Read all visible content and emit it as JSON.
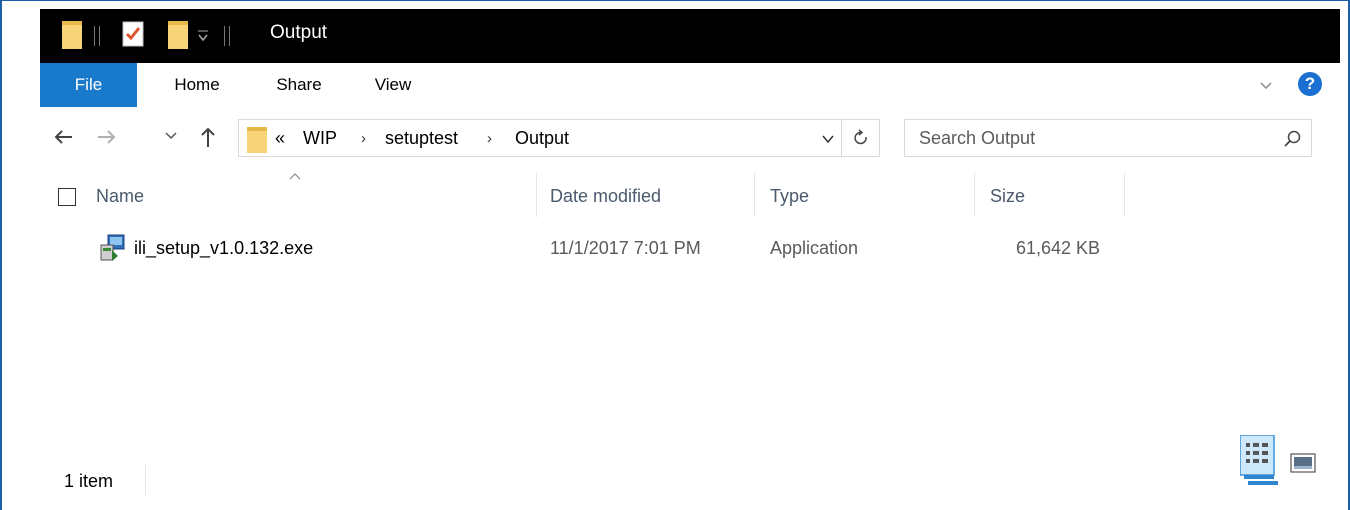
{
  "window": {
    "title": "Output"
  },
  "ribbon": {
    "tabs": [
      {
        "label": "File",
        "active": true
      },
      {
        "label": "Home"
      },
      {
        "label": "Share"
      },
      {
        "label": "View"
      }
    ]
  },
  "address": {
    "overflow": "«",
    "crumbs": [
      "WIP",
      "setuptest",
      "Output"
    ]
  },
  "search": {
    "placeholder": "Search Output"
  },
  "columns": {
    "name": "Name",
    "date": "Date modified",
    "type": "Type",
    "size": "Size"
  },
  "files": [
    {
      "name": "ili_setup_v1.0.132.exe",
      "date": "11/1/2017 7:01 PM",
      "type": "Application",
      "size": "61,642 KB",
      "icon": "installer-exe-icon"
    }
  ],
  "status": {
    "item_count": "1 item"
  },
  "colors": {
    "accent": "#1979ca",
    "titlebar": "#000000",
    "help": "#1a6fd1",
    "header_text": "#4b5a6d"
  }
}
